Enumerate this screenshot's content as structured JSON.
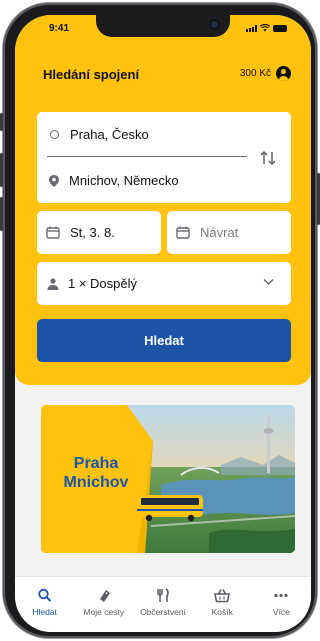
{
  "status_bar": {
    "time": "9:41"
  },
  "header": {
    "title": "Hledání spojení",
    "credit": "300 Kč",
    "account_icon": "account-circle-icon"
  },
  "search_form": {
    "from": "Praha, Česko",
    "to": "Mnichov, Německo",
    "date": "St, 3. 8.",
    "return_placeholder": "Návrat",
    "passengers": "1 × Dospělý",
    "search_button": "Hledat"
  },
  "banner": {
    "text": "Praha Mnichov"
  },
  "tabbar": {
    "items": [
      {
        "label": "Hledat",
        "icon": "search-icon",
        "active": true
      },
      {
        "label": "Moje cesty",
        "icon": "ticket-icon",
        "active": false
      },
      {
        "label": "Občerstvení",
        "icon": "cutlery-icon",
        "active": false
      },
      {
        "label": "Košík",
        "icon": "basket-icon",
        "active": false
      },
      {
        "label": "Více",
        "icon": "more-icon",
        "active": false
      }
    ]
  },
  "colors": {
    "brand_yellow": "#ffc20e",
    "brand_blue": "#1c55a8"
  }
}
